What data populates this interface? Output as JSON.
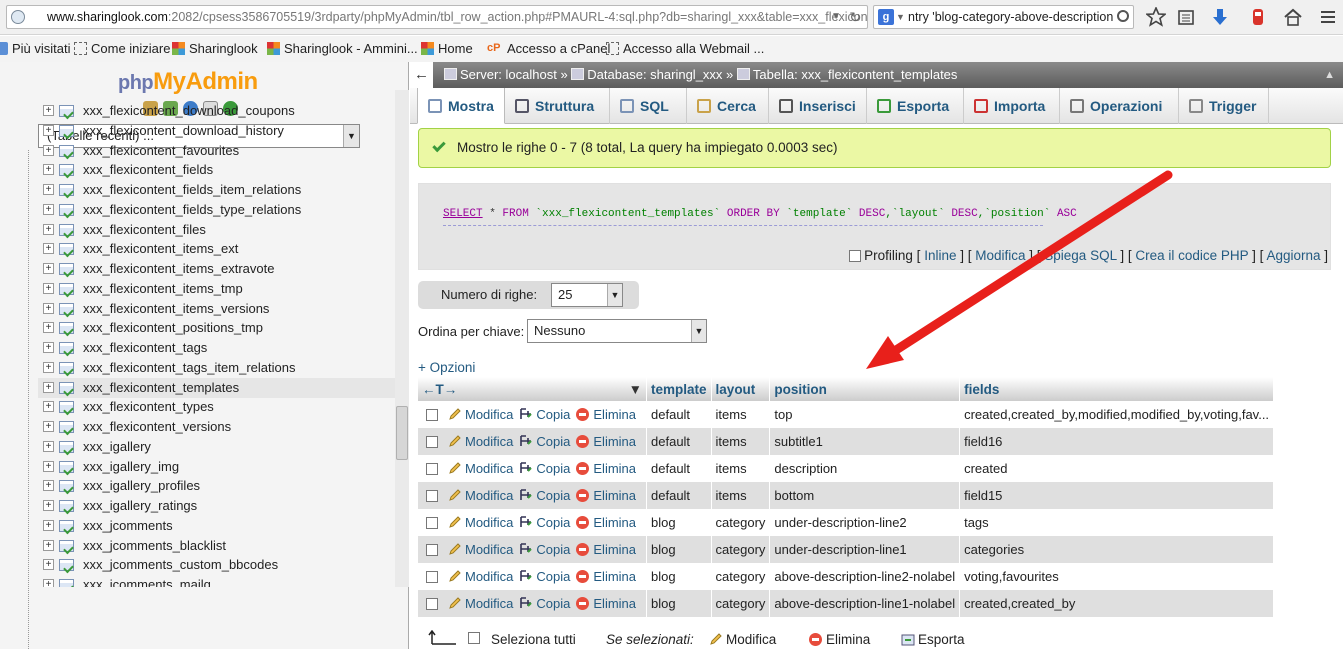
{
  "browser": {
    "url_host": "www.sharinglook.com",
    "url_rest": ":2082/cpsess3586705519/3rdparty/phpMyAdmin/tbl_row_action.php#PMAURL-4:sql.php?db=sharingl_xxx&table=xxx_flexicon",
    "search_query": "ntry 'blog-category-above-description",
    "bookmarks": [
      "Più visitati",
      "Come iniziare",
      "Sharinglook",
      "Sharinglook - Ammini...",
      "Home",
      "Accesso a cPanel",
      "Accesso alla Webmail ..."
    ]
  },
  "sidebar": {
    "logo_php": "php",
    "logo_myadmin": "MyAdmin",
    "recent_tables": "(Tabelle recenti) ...",
    "tables": [
      "xxx_flexicontent_download_coupons",
      "xxx_flexicontent_download_history",
      "xxx_flexicontent_favourites",
      "xxx_flexicontent_fields",
      "xxx_flexicontent_fields_item_relations",
      "xxx_flexicontent_fields_type_relations",
      "xxx_flexicontent_files",
      "xxx_flexicontent_items_ext",
      "xxx_flexicontent_items_extravote",
      "xxx_flexicontent_items_tmp",
      "xxx_flexicontent_items_versions",
      "xxx_flexicontent_positions_tmp",
      "xxx_flexicontent_tags",
      "xxx_flexicontent_tags_item_relations",
      "xxx_flexicontent_templates",
      "xxx_flexicontent_types",
      "xxx_flexicontent_versions",
      "xxx_igallery",
      "xxx_igallery_img",
      "xxx_igallery_profiles",
      "xxx_igallery_ratings",
      "xxx_jcomments",
      "xxx_jcomments_blacklist",
      "xxx_jcomments_custom_bbcodes",
      "xxx_jcomments_mailq"
    ],
    "selected_table": "xxx_flexicontent_templates"
  },
  "breadcrumb": {
    "server": "Server: localhost",
    "database": "Database: sharingl_xxx",
    "table": "Tabella: xxx_flexicontent_templates"
  },
  "tabs": [
    "Mostra",
    "Struttura",
    "SQL",
    "Cerca",
    "Inserisci",
    "Esporta",
    "Importa",
    "Operazioni",
    "Trigger"
  ],
  "message": "Mostro le righe 0 - 7 (8 total, La query ha impiegato 0.0003 sec)",
  "sql": {
    "select": "SELECT",
    "star": " * ",
    "from": "FROM",
    "table": " `xxx_flexicontent_templates` ",
    "orderby": "ORDER BY",
    "c1": " `template` ",
    "desc1": "DESC",
    "c2": ",`layout` ",
    "desc2": "DESC",
    "c3": ",`position` ",
    "asc": "ASC"
  },
  "sql_links": {
    "profiling": "Profiling",
    "inline": "Inline",
    "modifica": "Modifica",
    "spiega": "Spiega SQL",
    "php": "Crea il codice PHP",
    "aggiorna": "Aggiorna"
  },
  "rowcount": {
    "label": "Numero di righe:",
    "value": "25"
  },
  "orderby": {
    "label": "Ordina per chiave:",
    "value": "Nessuno"
  },
  "options_link": "+ Opzioni",
  "columns": [
    "template",
    "layout",
    "position",
    "fields"
  ],
  "row_actions": {
    "edit": "Modifica",
    "copy": "Copia",
    "delete": "Elimina"
  },
  "rows": [
    {
      "template": "default",
      "layout": "items",
      "position": "top",
      "fields": "created,created_by,modified,modified_by,voting,fav..."
    },
    {
      "template": "default",
      "layout": "items",
      "position": "subtitle1",
      "fields": "field16"
    },
    {
      "template": "default",
      "layout": "items",
      "position": "description",
      "fields": "created"
    },
    {
      "template": "default",
      "layout": "items",
      "position": "bottom",
      "fields": "field15"
    },
    {
      "template": "blog",
      "layout": "category",
      "position": "under-description-line2",
      "fields": "tags"
    },
    {
      "template": "blog",
      "layout": "category",
      "position": "under-description-line1",
      "fields": "categories"
    },
    {
      "template": "blog",
      "layout": "category",
      "position": "above-description-line2-nolabel",
      "fields": "voting,favourites"
    },
    {
      "template": "blog",
      "layout": "category",
      "position": "above-description-line1-nolabel",
      "fields": "created,created_by"
    }
  ],
  "bottom": {
    "select_all": "Seleziona tutti",
    "with_selected": "Se selezionati:",
    "edit": "Modifica",
    "delete": "Elimina",
    "export": "Esporta"
  },
  "colors": {
    "link": "#235a81",
    "success_bg": "#ebf8a4",
    "arrow": "#e8201b"
  }
}
